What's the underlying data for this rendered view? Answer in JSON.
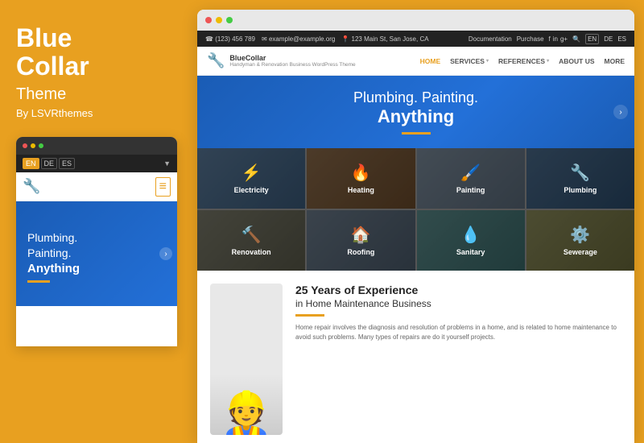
{
  "left": {
    "title_line1": "Blue",
    "title_line2": "Collar",
    "subtitle": "Theme",
    "by": "By LSVRthemes"
  },
  "mobile": {
    "dots": [
      "red",
      "yellow",
      "green"
    ],
    "lang_buttons": [
      "EN",
      "DE",
      "ES"
    ],
    "active_lang": "EN",
    "hero_text1": "Plumbing.",
    "hero_text2": "Painting.",
    "hero_bold": "Anything"
  },
  "browser": {
    "dots": [
      "red",
      "yellow",
      "green"
    ]
  },
  "infobar": {
    "phone": "☎ (123) 456 789",
    "email": "✉ example@example.org",
    "address": "📍 123 Main St, San Jose, CA",
    "doc_link": "Documentation",
    "purchase_link": "Purchase",
    "lang_en": "EN",
    "lang_de": "DE",
    "lang_es": "ES"
  },
  "nav": {
    "logo_name": "BlueCollar",
    "logo_tagline": "Handyman & Renovation Business WordPress Theme",
    "links": [
      {
        "label": "HOME",
        "active": true,
        "has_arrow": false
      },
      {
        "label": "SERVICES",
        "active": false,
        "has_arrow": true
      },
      {
        "label": "REFERENCES",
        "active": false,
        "has_arrow": true
      },
      {
        "label": "ABOUT US",
        "active": false,
        "has_arrow": false
      },
      {
        "label": "MORE",
        "active": false,
        "has_arrow": false
      }
    ]
  },
  "hero": {
    "text1": "Plumbing. Painting.",
    "bold": "Anything"
  },
  "services": [
    {
      "id": "electricity",
      "label": "Electricity",
      "icon": "⚡",
      "bg_class": "bg-electricity"
    },
    {
      "id": "heating",
      "label": "Heating",
      "icon": "🔥",
      "bg_class": "bg-heating"
    },
    {
      "id": "painting",
      "label": "Painting",
      "icon": "🖌️",
      "bg_class": "bg-painting"
    },
    {
      "id": "plumbing",
      "label": "Plumbing",
      "icon": "🔧",
      "bg_class": "bg-plumbing"
    },
    {
      "id": "renovation",
      "label": "Renovation",
      "icon": "🔨",
      "bg_class": "bg-renovation"
    },
    {
      "id": "roofing",
      "label": "Roofing",
      "icon": "🏠",
      "bg_class": "bg-roofing"
    },
    {
      "id": "sanitary",
      "label": "Sanitary",
      "icon": "💧",
      "bg_class": "bg-sanitary"
    },
    {
      "id": "sewerage",
      "label": "Sewerage",
      "icon": "⚙️",
      "bg_class": "bg-sewerage"
    }
  ],
  "experience": {
    "title": "25 Years of Experience",
    "subtitle": "in Home Maintenance Business",
    "text": "Home repair involves the diagnosis and resolution of problems in a home, and is related to home maintenance to avoid such problems. Many types of repairs are do it yourself projects."
  }
}
